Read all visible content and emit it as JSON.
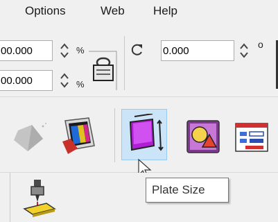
{
  "menu": {
    "items": [
      {
        "label": "Options"
      },
      {
        "label": "Web"
      },
      {
        "label": "Help"
      }
    ]
  },
  "transform": {
    "x_value": "00.000",
    "y_value": "00.000",
    "percent_symbol": "%",
    "rotation_value": "0.000",
    "degree_symbol": "o"
  },
  "icons": {
    "lock": "lock-icon",
    "rotate": "rotate-icon",
    "shape": "gray-diamond-icon",
    "printer": "print-output-icon",
    "plate": "plate-size-icon",
    "media": "media-shapes-icon",
    "window": "window-properties-icon",
    "engrave": "engraving-tool-icon"
  },
  "tooltip": {
    "text": "Plate Size"
  },
  "colors": {
    "toolbar_bg": "#f0f0f0",
    "pressed_bg": "#cce4f7",
    "pressed_border": "#99c9ef",
    "plate_magenta": "#b01fd6"
  }
}
